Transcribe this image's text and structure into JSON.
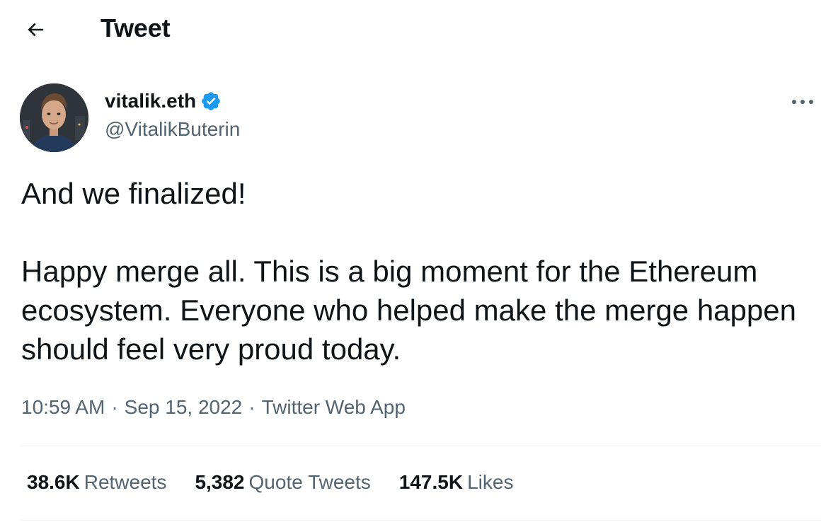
{
  "header": {
    "back_icon": "arrow-left-icon",
    "title": "Tweet"
  },
  "author": {
    "display_name": "vitalik.eth",
    "verified_icon": "verified-badge-icon",
    "handle": "@VitalikButerin"
  },
  "more_icon": "more-horizontal-icon",
  "tweet": {
    "line1": "And we finalized!",
    "line2": "Happy merge all. This is a big moment for the Ethereum ecosystem. Everyone who helped make the merge happen should feel very proud today."
  },
  "meta": {
    "time": "10:59 AM",
    "separator": "·",
    "date": "Sep 15, 2022",
    "source": "Twitter Web App"
  },
  "stats": [
    {
      "value": "38.6K",
      "label": "Retweets"
    },
    {
      "value": "5,382",
      "label": "Quote Tweets"
    },
    {
      "value": "147.5K",
      "label": "Likes"
    }
  ],
  "colors": {
    "text_primary": "#0f1419",
    "text_secondary": "#536471",
    "verified_blue": "#1d9bf0",
    "divider": "#eff3f4"
  }
}
